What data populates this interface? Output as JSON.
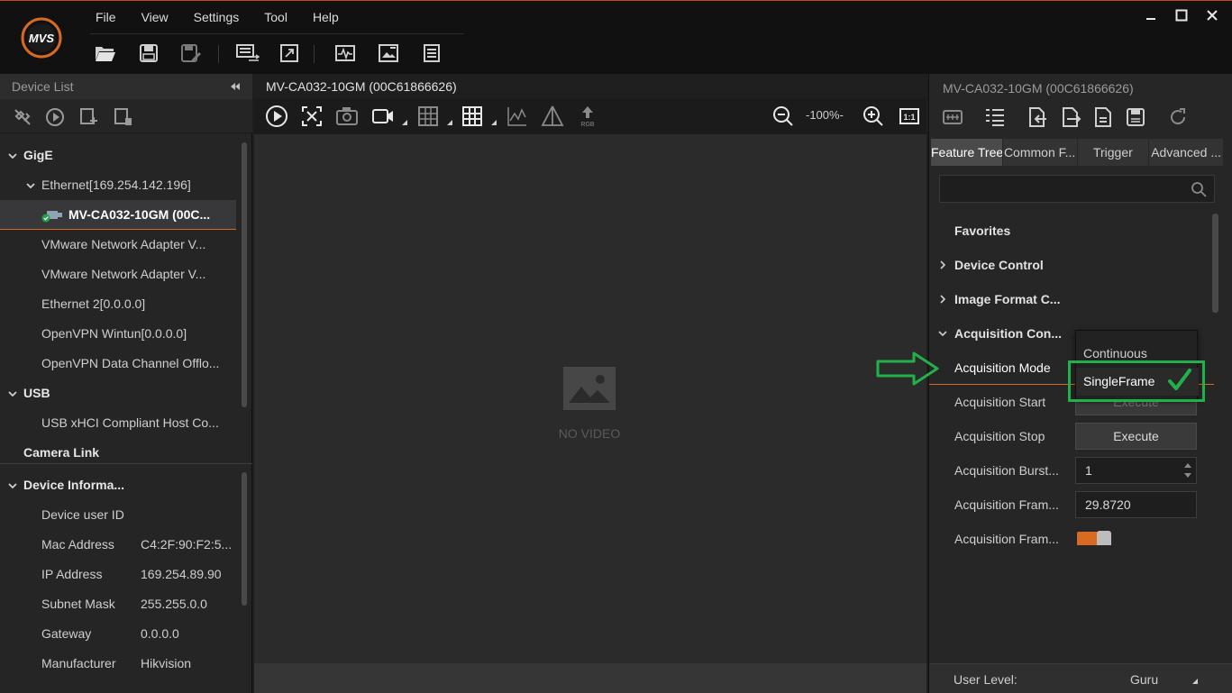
{
  "app": {
    "name": "MVS",
    "accent_color": "#d86a22",
    "annotation_color": "#22b04a"
  },
  "menu": [
    "File",
    "View",
    "Settings",
    "Tool",
    "Help"
  ],
  "toolbar_icons": [
    "open-folder-icon",
    "save-icon",
    "save-as-icon",
    "display-settings-icon",
    "resize-icon",
    "waveform-icon",
    "image-edit-icon",
    "list-icon"
  ],
  "window_controls": [
    "minimize-icon",
    "maximize-icon",
    "close-icon"
  ],
  "device_list": {
    "title": "Device List",
    "tree": [
      {
        "label": "GigE",
        "type": "group"
      },
      {
        "label": "Ethernet[169.254.142.196]",
        "type": "adapter"
      },
      {
        "label": "MV-CA032-10GM (00C...",
        "type": "camera",
        "selected": true
      },
      {
        "label": "VMware Network Adapter V...",
        "type": "item"
      },
      {
        "label": "VMware Network Adapter V...",
        "type": "item"
      },
      {
        "label": "Ethernet 2[0.0.0.0]",
        "type": "item"
      },
      {
        "label": "OpenVPN Wintun[0.0.0.0]",
        "type": "item"
      },
      {
        "label": "OpenVPN Data Channel Offlo...",
        "type": "item"
      },
      {
        "label": "USB",
        "type": "group"
      },
      {
        "label": "USB xHCI Compliant Host Co...",
        "type": "item"
      },
      {
        "label": "Camera Link",
        "type": "group-nocaret"
      }
    ]
  },
  "device_info": {
    "title": "Device Informa...",
    "rows": [
      {
        "key": "Device user ID",
        "value": ""
      },
      {
        "key": "Mac Address",
        "value": "C4:2F:90:F2:5..."
      },
      {
        "key": "IP Address",
        "value": "169.254.89.90"
      },
      {
        "key": "Subnet Mask",
        "value": "255.255.0.0"
      },
      {
        "key": "Gateway",
        "value": "0.0.0.0"
      },
      {
        "key": "Manufacturer",
        "value": "Hikvision"
      }
    ]
  },
  "camera_view": {
    "title": "MV-CA032-10GM (00C61866626)",
    "zoom": "-100%-",
    "no_video_text": "NO VIDEO",
    "rgb_label": "RGB"
  },
  "properties": {
    "title": "MV-CA032-10GM (00C61866626)",
    "tabs": [
      "Feature Tree",
      "Common F...",
      "Trigger",
      "Advanced ..."
    ],
    "active_tab": 0,
    "search_placeholder": "",
    "features": [
      {
        "label": "Favorites",
        "type": "cat-nocaret"
      },
      {
        "label": "Device Control",
        "type": "cat"
      },
      {
        "label": "Image Format C...",
        "type": "cat"
      },
      {
        "label": "Acquisition Con...",
        "type": "cat-open"
      },
      {
        "label": "Acquisition Mode",
        "type": "enum",
        "value": "SingleFrame"
      },
      {
        "label": "Acquisition Start",
        "type": "command",
        "button": "Execute",
        "disabled": true
      },
      {
        "label": "Acquisition Stop",
        "type": "command",
        "button": "Execute"
      },
      {
        "label": "Acquisition Burst...",
        "type": "number",
        "value": "1"
      },
      {
        "label": "Acquisition Fram...",
        "type": "number",
        "value": "29.8720"
      },
      {
        "label": "Acquisition Fram...",
        "type": "toggle",
        "value": "on"
      }
    ],
    "dropdown_options": [
      "Continuous",
      "SingleFrame"
    ],
    "dropdown_selected": "SingleFrame",
    "user_level_label": "User Level:",
    "user_level": "Guru"
  }
}
